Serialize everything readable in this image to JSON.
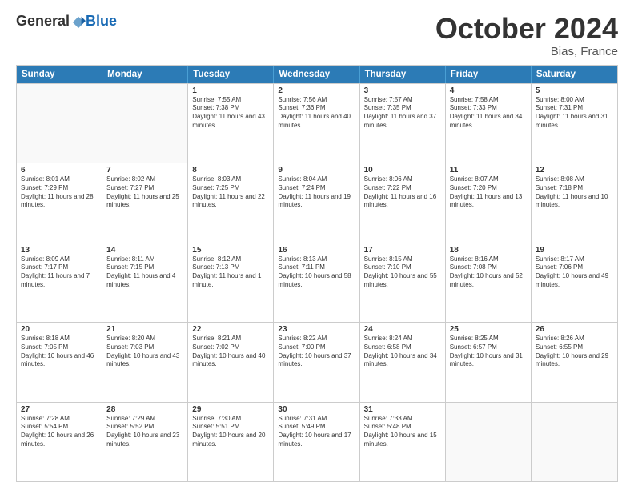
{
  "header": {
    "logo_general": "General",
    "logo_blue": "Blue",
    "month": "October 2024",
    "location": "Bias, France"
  },
  "days_of_week": [
    "Sunday",
    "Monday",
    "Tuesday",
    "Wednesday",
    "Thursday",
    "Friday",
    "Saturday"
  ],
  "weeks": [
    [
      {
        "day": "",
        "sunrise": "",
        "sunset": "",
        "daylight": "",
        "empty": true
      },
      {
        "day": "",
        "sunrise": "",
        "sunset": "",
        "daylight": "",
        "empty": true
      },
      {
        "day": "1",
        "sunrise": "Sunrise: 7:55 AM",
        "sunset": "Sunset: 7:38 PM",
        "daylight": "Daylight: 11 hours and 43 minutes.",
        "empty": false
      },
      {
        "day": "2",
        "sunrise": "Sunrise: 7:56 AM",
        "sunset": "Sunset: 7:36 PM",
        "daylight": "Daylight: 11 hours and 40 minutes.",
        "empty": false
      },
      {
        "day": "3",
        "sunrise": "Sunrise: 7:57 AM",
        "sunset": "Sunset: 7:35 PM",
        "daylight": "Daylight: 11 hours and 37 minutes.",
        "empty": false
      },
      {
        "day": "4",
        "sunrise": "Sunrise: 7:58 AM",
        "sunset": "Sunset: 7:33 PM",
        "daylight": "Daylight: 11 hours and 34 minutes.",
        "empty": false
      },
      {
        "day": "5",
        "sunrise": "Sunrise: 8:00 AM",
        "sunset": "Sunset: 7:31 PM",
        "daylight": "Daylight: 11 hours and 31 minutes.",
        "empty": false
      }
    ],
    [
      {
        "day": "6",
        "sunrise": "Sunrise: 8:01 AM",
        "sunset": "Sunset: 7:29 PM",
        "daylight": "Daylight: 11 hours and 28 minutes.",
        "empty": false
      },
      {
        "day": "7",
        "sunrise": "Sunrise: 8:02 AM",
        "sunset": "Sunset: 7:27 PM",
        "daylight": "Daylight: 11 hours and 25 minutes.",
        "empty": false
      },
      {
        "day": "8",
        "sunrise": "Sunrise: 8:03 AM",
        "sunset": "Sunset: 7:25 PM",
        "daylight": "Daylight: 11 hours and 22 minutes.",
        "empty": false
      },
      {
        "day": "9",
        "sunrise": "Sunrise: 8:04 AM",
        "sunset": "Sunset: 7:24 PM",
        "daylight": "Daylight: 11 hours and 19 minutes.",
        "empty": false
      },
      {
        "day": "10",
        "sunrise": "Sunrise: 8:06 AM",
        "sunset": "Sunset: 7:22 PM",
        "daylight": "Daylight: 11 hours and 16 minutes.",
        "empty": false
      },
      {
        "day": "11",
        "sunrise": "Sunrise: 8:07 AM",
        "sunset": "Sunset: 7:20 PM",
        "daylight": "Daylight: 11 hours and 13 minutes.",
        "empty": false
      },
      {
        "day": "12",
        "sunrise": "Sunrise: 8:08 AM",
        "sunset": "Sunset: 7:18 PM",
        "daylight": "Daylight: 11 hours and 10 minutes.",
        "empty": false
      }
    ],
    [
      {
        "day": "13",
        "sunrise": "Sunrise: 8:09 AM",
        "sunset": "Sunset: 7:17 PM",
        "daylight": "Daylight: 11 hours and 7 minutes.",
        "empty": false
      },
      {
        "day": "14",
        "sunrise": "Sunrise: 8:11 AM",
        "sunset": "Sunset: 7:15 PM",
        "daylight": "Daylight: 11 hours and 4 minutes.",
        "empty": false
      },
      {
        "day": "15",
        "sunrise": "Sunrise: 8:12 AM",
        "sunset": "Sunset: 7:13 PM",
        "daylight": "Daylight: 11 hours and 1 minute.",
        "empty": false
      },
      {
        "day": "16",
        "sunrise": "Sunrise: 8:13 AM",
        "sunset": "Sunset: 7:11 PM",
        "daylight": "Daylight: 10 hours and 58 minutes.",
        "empty": false
      },
      {
        "day": "17",
        "sunrise": "Sunrise: 8:15 AM",
        "sunset": "Sunset: 7:10 PM",
        "daylight": "Daylight: 10 hours and 55 minutes.",
        "empty": false
      },
      {
        "day": "18",
        "sunrise": "Sunrise: 8:16 AM",
        "sunset": "Sunset: 7:08 PM",
        "daylight": "Daylight: 10 hours and 52 minutes.",
        "empty": false
      },
      {
        "day": "19",
        "sunrise": "Sunrise: 8:17 AM",
        "sunset": "Sunset: 7:06 PM",
        "daylight": "Daylight: 10 hours and 49 minutes.",
        "empty": false
      }
    ],
    [
      {
        "day": "20",
        "sunrise": "Sunrise: 8:18 AM",
        "sunset": "Sunset: 7:05 PM",
        "daylight": "Daylight: 10 hours and 46 minutes.",
        "empty": false
      },
      {
        "day": "21",
        "sunrise": "Sunrise: 8:20 AM",
        "sunset": "Sunset: 7:03 PM",
        "daylight": "Daylight: 10 hours and 43 minutes.",
        "empty": false
      },
      {
        "day": "22",
        "sunrise": "Sunrise: 8:21 AM",
        "sunset": "Sunset: 7:02 PM",
        "daylight": "Daylight: 10 hours and 40 minutes.",
        "empty": false
      },
      {
        "day": "23",
        "sunrise": "Sunrise: 8:22 AM",
        "sunset": "Sunset: 7:00 PM",
        "daylight": "Daylight: 10 hours and 37 minutes.",
        "empty": false
      },
      {
        "day": "24",
        "sunrise": "Sunrise: 8:24 AM",
        "sunset": "Sunset: 6:58 PM",
        "daylight": "Daylight: 10 hours and 34 minutes.",
        "empty": false
      },
      {
        "day": "25",
        "sunrise": "Sunrise: 8:25 AM",
        "sunset": "Sunset: 6:57 PM",
        "daylight": "Daylight: 10 hours and 31 minutes.",
        "empty": false
      },
      {
        "day": "26",
        "sunrise": "Sunrise: 8:26 AM",
        "sunset": "Sunset: 6:55 PM",
        "daylight": "Daylight: 10 hours and 29 minutes.",
        "empty": false
      }
    ],
    [
      {
        "day": "27",
        "sunrise": "Sunrise: 7:28 AM",
        "sunset": "Sunset: 5:54 PM",
        "daylight": "Daylight: 10 hours and 26 minutes.",
        "empty": false
      },
      {
        "day": "28",
        "sunrise": "Sunrise: 7:29 AM",
        "sunset": "Sunset: 5:52 PM",
        "daylight": "Daylight: 10 hours and 23 minutes.",
        "empty": false
      },
      {
        "day": "29",
        "sunrise": "Sunrise: 7:30 AM",
        "sunset": "Sunset: 5:51 PM",
        "daylight": "Daylight: 10 hours and 20 minutes.",
        "empty": false
      },
      {
        "day": "30",
        "sunrise": "Sunrise: 7:31 AM",
        "sunset": "Sunset: 5:49 PM",
        "daylight": "Daylight: 10 hours and 17 minutes.",
        "empty": false
      },
      {
        "day": "31",
        "sunrise": "Sunrise: 7:33 AM",
        "sunset": "Sunset: 5:48 PM",
        "daylight": "Daylight: 10 hours and 15 minutes.",
        "empty": false
      },
      {
        "day": "",
        "sunrise": "",
        "sunset": "",
        "daylight": "",
        "empty": true
      },
      {
        "day": "",
        "sunrise": "",
        "sunset": "",
        "daylight": "",
        "empty": true
      }
    ]
  ]
}
